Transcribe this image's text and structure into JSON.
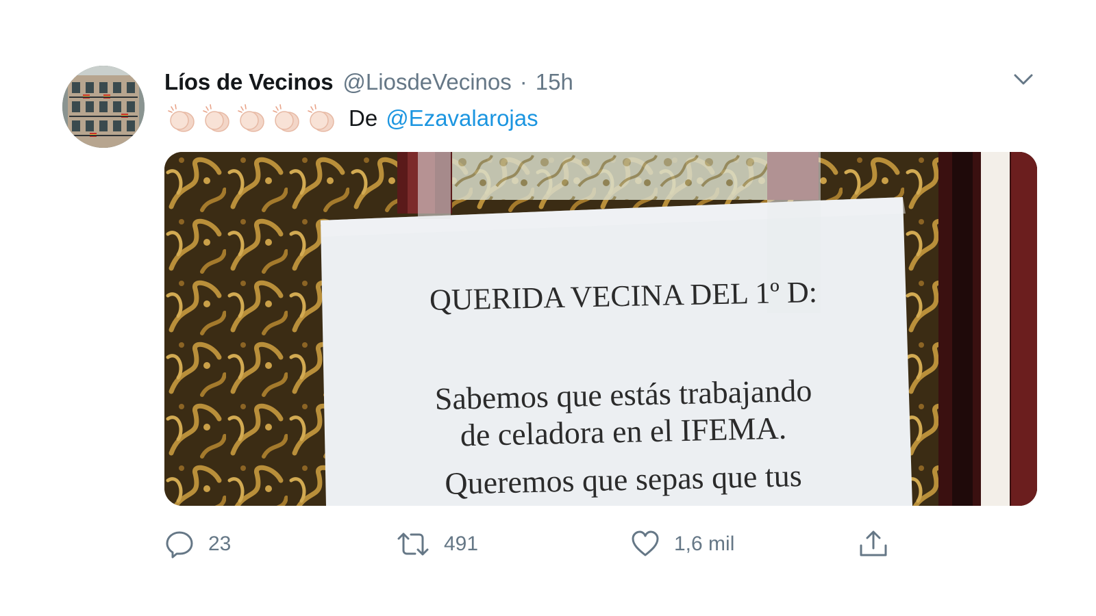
{
  "tweet": {
    "display_name": "Líos de Vecinos",
    "handle": "@LiosdeVecinos",
    "separator": "·",
    "time": "15h",
    "text_word": "De",
    "mention": "@Ezavalarojas",
    "clap_emoji_count": 5,
    "clap_emoji": "clapping-hands-icon",
    "mention_color": "#1b95e0"
  },
  "media": {
    "sign_title": "QUERIDA VECINA DEL 1º D:",
    "sign_line_1": "Sabemos que estás trabajando",
    "sign_line_2": "de celadora en el IFEMA.",
    "sign_line_3": "Queremos que sepas que tus"
  },
  "actions": {
    "reply_count": "23",
    "retweet_count": "491",
    "like_count": "1,6 mil",
    "reply_icon": "speech-bubble-icon",
    "retweet_icon": "retweet-icon",
    "like_icon": "heart-icon",
    "share_icon": "share-icon"
  }
}
